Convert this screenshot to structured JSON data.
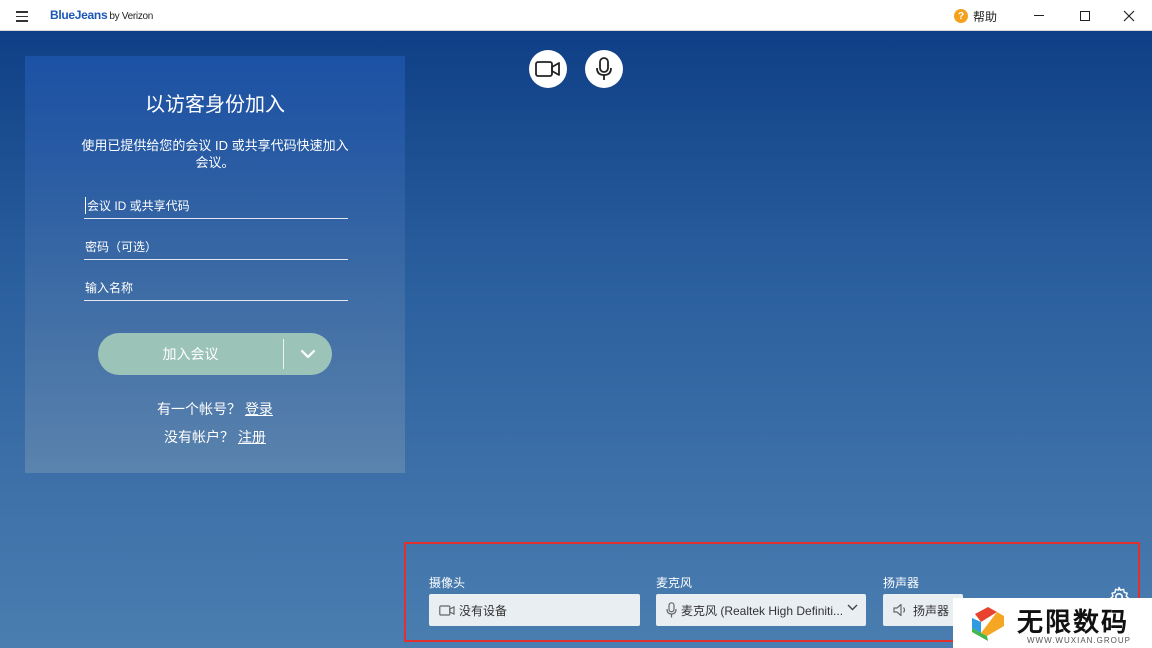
{
  "titlebar": {
    "logo_brand": "BlueJeans",
    "logo_suffix": "by Verizon",
    "help_label": "帮助"
  },
  "panel": {
    "title": "以访客身份加入",
    "description": "使用已提供给您的会议 ID 或共享代码快速加入会议。",
    "meeting_id_placeholder": "会议 ID 或共享代码",
    "passcode_placeholder": "密码（可选）",
    "name_placeholder": "输入名称",
    "join_button": "加入会议",
    "have_account_text": "有一个帐号？",
    "login_link": "登录",
    "no_account_text": "没有帐户？",
    "register_link": "注册"
  },
  "devices": {
    "camera_label": "摄像头",
    "camera_value": "没有设备",
    "mic_label": "麦克风",
    "mic_value": "麦克风 (Realtek High Definiti...",
    "speaker_label": "扬声器",
    "speaker_value": "扬声器"
  },
  "watermark": {
    "text": "无限数码",
    "sub": "WWW.WUXIAN.GROUP"
  },
  "colors": {
    "brand": "#1b57b8",
    "join_button": "#9cc3b8",
    "highlight_border": "#e03030",
    "help_icon": "#f4a11d"
  }
}
